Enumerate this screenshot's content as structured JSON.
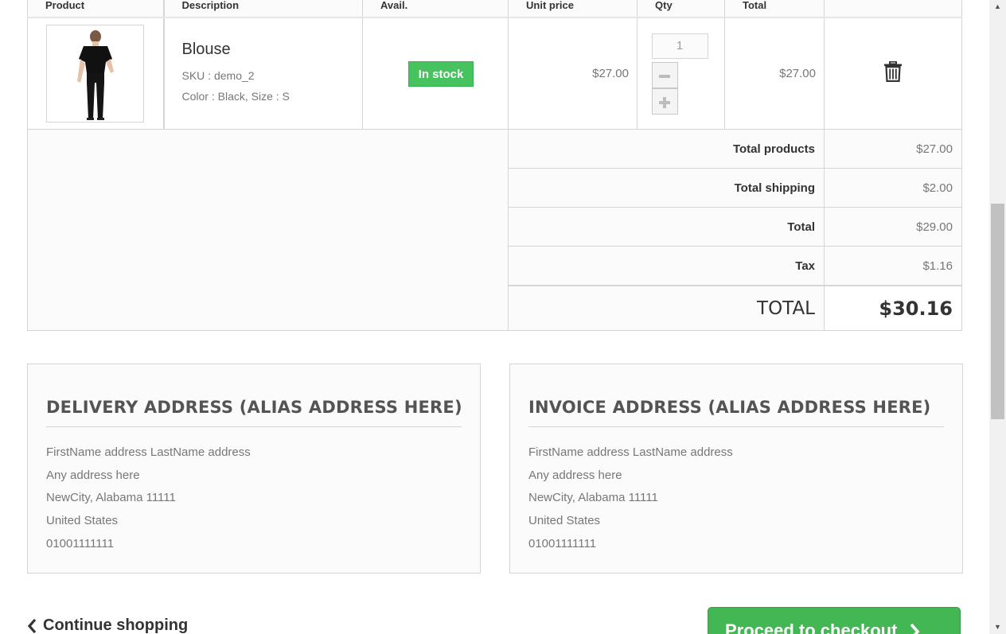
{
  "table": {
    "headers": [
      "Product",
      "Description",
      "Avail.",
      "Unit price",
      "Qty",
      "Total",
      ""
    ]
  },
  "product": {
    "name": "Blouse",
    "sku": "SKU : demo_2",
    "attributes": "Color : Black, Size : S",
    "availability": "In stock",
    "unit_price": "$27.00",
    "qty": "1",
    "total": "$27.00",
    "image_icon": "blouse-product-image",
    "delete_icon": "trash-icon"
  },
  "totals": {
    "rows": [
      {
        "label": "Total products",
        "value": "$27.00"
      },
      {
        "label": "Total shipping",
        "value": "$2.00"
      },
      {
        "label": "Total",
        "value": "$29.00"
      },
      {
        "label": "Tax",
        "value": "$1.16"
      }
    ],
    "grand_label": "TOTAL",
    "grand_value": "$30.16"
  },
  "delivery_address": {
    "title": "DELIVERY ADDRESS (ALIAS ADDRESS HERE)",
    "lines": [
      "FirstName address LastName address",
      "Any address here",
      "NewCity, Alabama 11111",
      "United States",
      "01001111111"
    ]
  },
  "invoice_address": {
    "title": "INVOICE ADDRESS (ALIAS ADDRESS HERE)",
    "lines": [
      "FirstName address LastName address",
      "Any address here",
      "NewCity, Alabama 11111",
      "United States",
      "01001111111"
    ]
  },
  "nav": {
    "continue_label": "Continue shopping",
    "checkout_label": "Proceed to checkout"
  },
  "colors": {
    "in_stock": "#46c35f",
    "checkout": "#43b754"
  }
}
